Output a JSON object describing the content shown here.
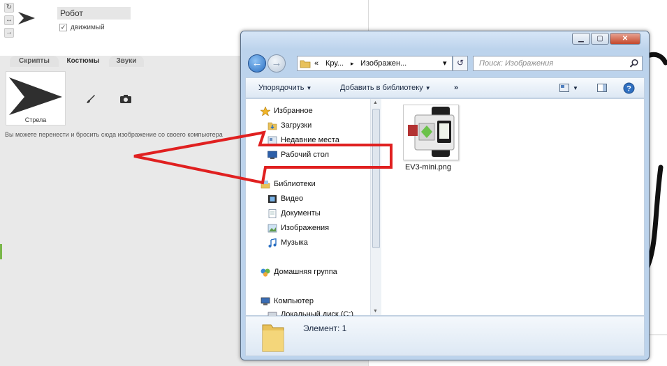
{
  "scratch": {
    "side_buttons": [
      "↻",
      "↔",
      "→"
    ],
    "sprite_name": "Робот",
    "draggable_check": "✓",
    "draggable_label": "движимый",
    "tabs": [
      "Скрипты",
      "Костюмы",
      "Звуки"
    ],
    "costume_label": "Стрела",
    "drop_hint": "Вы можете перенести и бросить сюда изображение со своего компьютера",
    "icons": [
      "arrow-icon",
      "brush-icon",
      "camera-icon"
    ]
  },
  "explorer": {
    "window_buttons": [
      "▁",
      "▢",
      "✕"
    ],
    "address": {
      "chevron": "«",
      "segment1": "Кру...",
      "separator": "▸",
      "segment2": "Изображен...",
      "dropdown": "▾"
    },
    "search_placeholder": "Поиск: Изображения",
    "toolbar": {
      "organize": "Упорядочить",
      "add_to_library": "Добавить в библиотеку",
      "more": "»"
    },
    "nav": {
      "favorites": "Избранное",
      "downloads": "Загрузки",
      "recent_places": "Недавние места",
      "desktop": "Рабочий стол",
      "libraries": "Библиотеки",
      "video": "Видео",
      "documents": "Документы",
      "images": "Изображения",
      "music": "Музыка",
      "homegroup": "Домашняя группа",
      "computer": "Компьютер",
      "local_disk": "Локальный диск (C:)"
    },
    "file": {
      "name": "EV3-mini.png"
    },
    "details": {
      "count": "Элемент: 1"
    }
  },
  "colors": {
    "accent_red": "#e02020",
    "window_frame": "#bcd3ec",
    "scratch_gray": "#e9e9e9"
  }
}
